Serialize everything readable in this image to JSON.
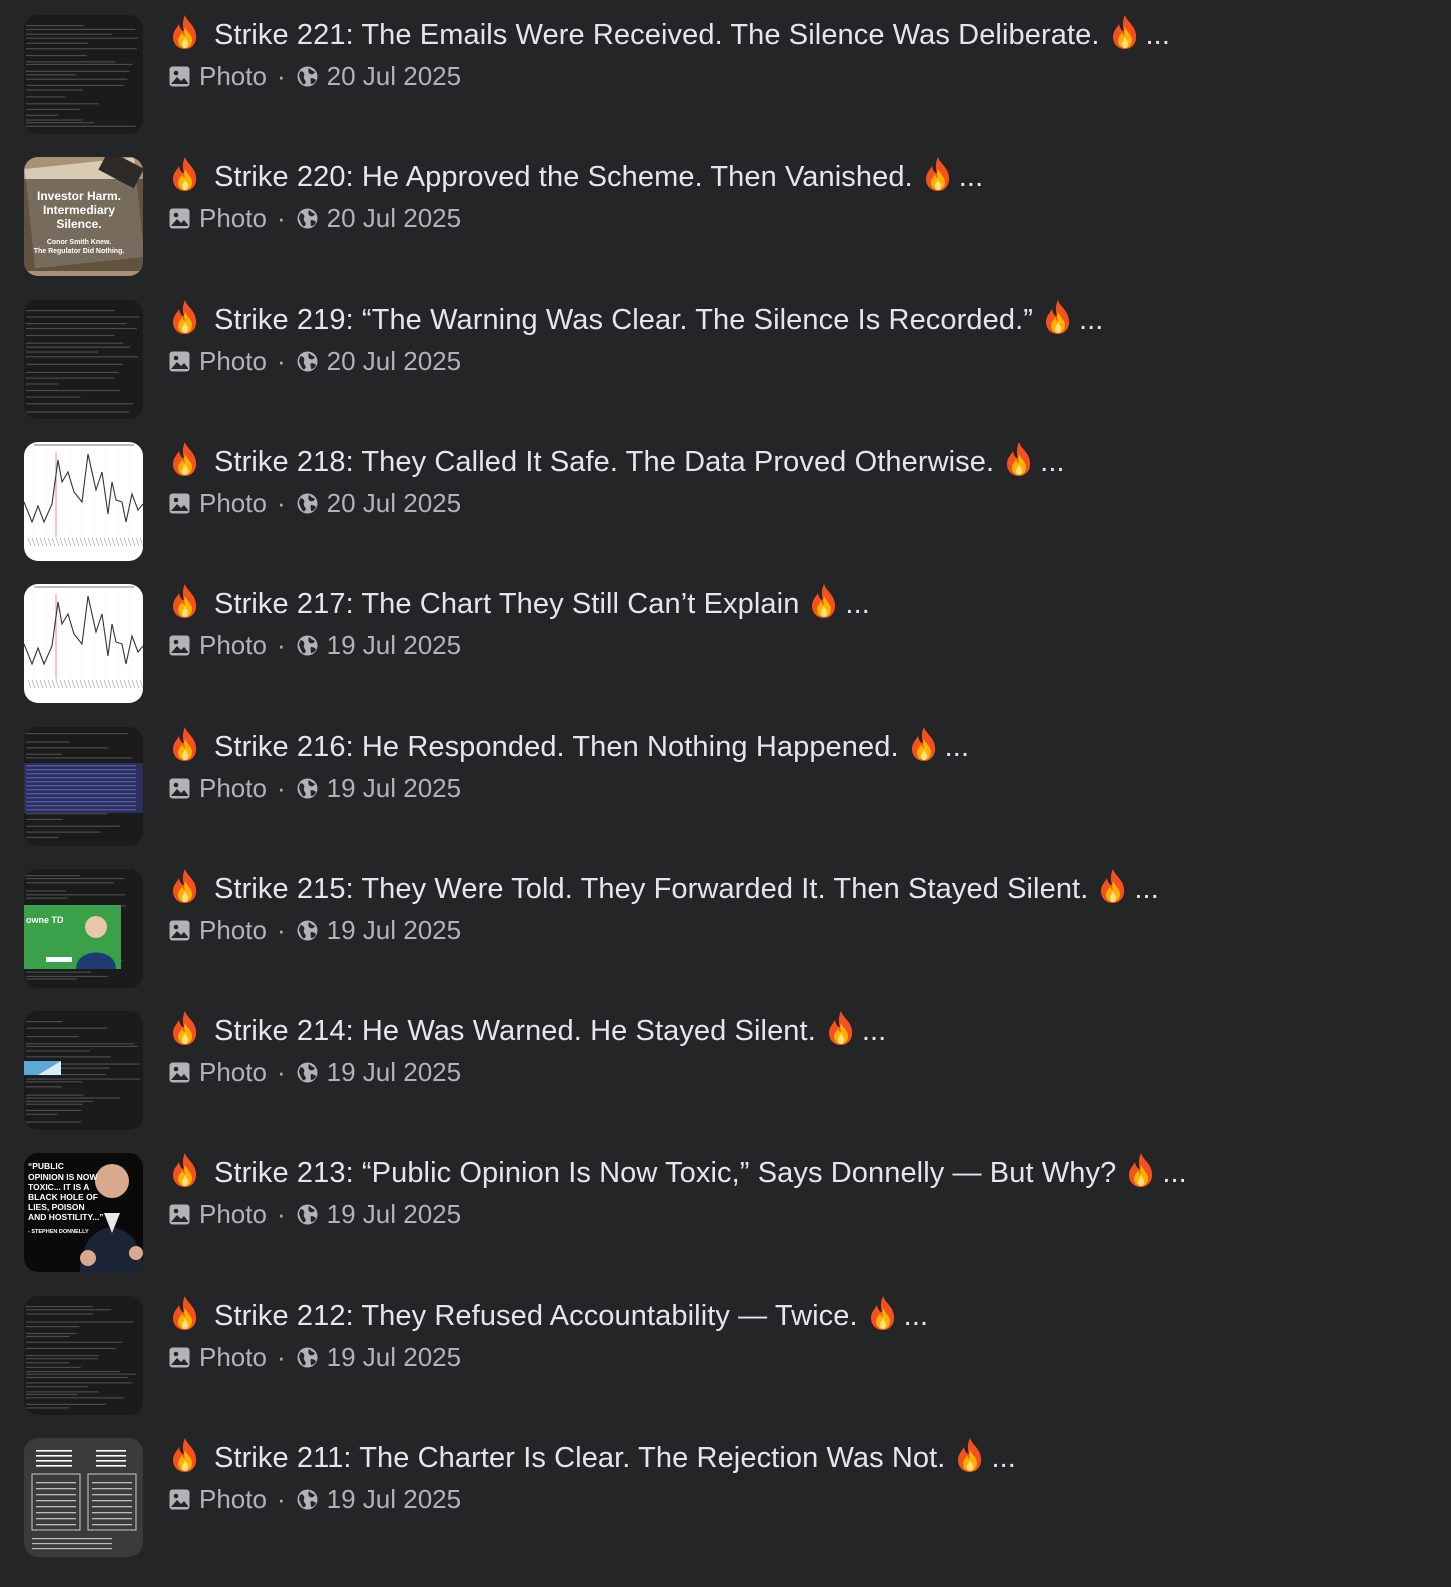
{
  "posts": [
    {
      "title": "Strike 221: The Emails Were Received. The Silence Was Deliberate.",
      "type": "Photo",
      "date": "20 Jul 2025",
      "thumb": "document-dark"
    },
    {
      "title": "Strike 220: He Approved the Scheme. Then Vanished.",
      "type": "Photo",
      "date": "20 Jul 2025",
      "thumb": "poster",
      "thumb_text": {
        "line1": "Investor Harm.",
        "line2": "Intermediary",
        "line3": "Silence.",
        "line4": "Conor Smith Knew.",
        "line5": "The Regulator Did Nothing."
      }
    },
    {
      "title": "Strike 219: “The Warning Was Clear. The Silence Is Recorded.”",
      "type": "Photo",
      "date": "20 Jul 2025",
      "thumb": "document-dark"
    },
    {
      "title": "Strike 218: They Called It Safe. The Data Proved Otherwise.",
      "type": "Photo",
      "date": "20 Jul 2025",
      "thumb": "line-chart"
    },
    {
      "title": "Strike 217: The Chart They Still Can’t Explain",
      "type": "Photo",
      "date": "19 Jul 2025",
      "thumb": "line-chart"
    },
    {
      "title": "Strike 216: He Responded. Then Nothing Happened.",
      "type": "Photo",
      "date": "19 Jul 2025",
      "thumb": "document-blue"
    },
    {
      "title": "Strike 215: They Were Told. They Forwarded It. Then Stayed Silent.",
      "type": "Photo",
      "date": "19 Jul 2025",
      "thumb": "document-green",
      "thumb_text": {
        "line1": "owne TD"
      }
    },
    {
      "title": "Strike 214: He Was Warned. He Stayed Silent.",
      "type": "Photo",
      "date": "19 Jul 2025",
      "thumb": "document-dark-2"
    },
    {
      "title": "Strike 213: “Public Opinion Is Now Toxic,” Says Donnelly — But Why?",
      "type": "Photo",
      "date": "19 Jul 2025",
      "thumb": "quote",
      "thumb_text": {
        "line1": "“PUBLIC",
        "line2": "OPINION IS NOW",
        "line3": "TOXIC... IT IS A",
        "line4": "BLACK HOLE OF",
        "line5": "LIES, POISON",
        "line6": "AND HOSTILITY...”",
        "line7": "- STEPHEN DONNELLY"
      }
    },
    {
      "title": "Strike 212: They Refused Accountability — Twice.",
      "type": "Photo",
      "date": "19 Jul 2025",
      "thumb": "document-dark"
    },
    {
      "title": "Strike 211: The Charter Is Clear. The Rejection Was Not.",
      "type": "Photo",
      "date": "19 Jul 2025",
      "thumb": "charter",
      "thumb_text": {
        "left_head": "PETI Admissibility Rules - Section 13",
        "right_head": "PETI Response",
        "left_body": "“Petitions may concern any matter which comes within the European Union’s fields of activity.”",
        "right_body": "Your petition has been declared inadmissible as it does not meet the criteria.",
        "source": "Source: EU Charter Tutorial - e-justice.europa.eu"
      }
    }
  ],
  "colors": {
    "background": "#242526",
    "title": "#e4e6eb",
    "meta": "#b0b3b8"
  },
  "icons": {
    "fire": "fire-icon",
    "photo": "photo-icon",
    "globe": "globe-icon"
  },
  "ellipsis": "..."
}
